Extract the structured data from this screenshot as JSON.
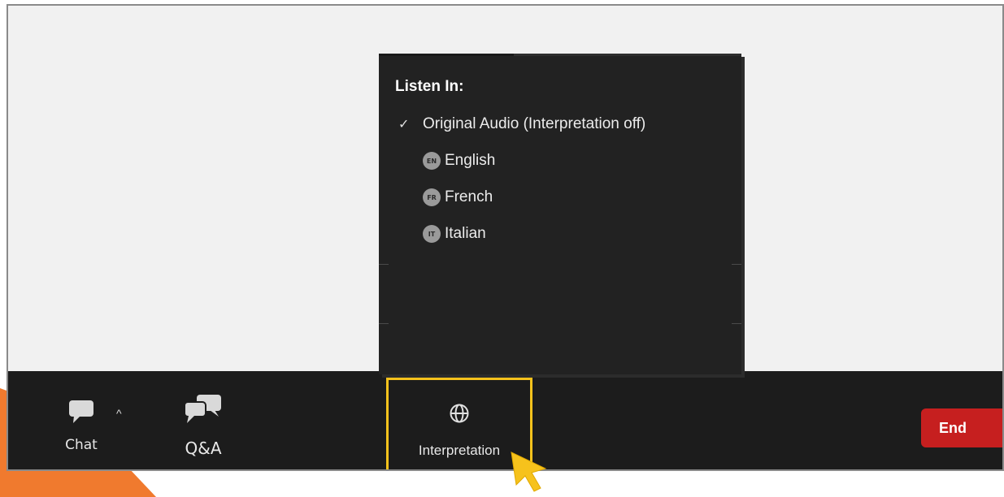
{
  "popup": {
    "header": "Listen In:",
    "original_option": {
      "label": "Original Audio (Interpretation off)",
      "checked": true
    },
    "languages": [
      {
        "code": "EN",
        "label": "English"
      },
      {
        "code": "FR",
        "label": "French"
      },
      {
        "code": "IT",
        "label": "Italian"
      }
    ]
  },
  "toolbar": {
    "chat_label": "Chat",
    "qa_label": "Q&A",
    "interpretation_label": "Interpretation",
    "end_label": "End"
  },
  "colors": {
    "toolbar_bg": "#1c1c1c",
    "popup_bg": "#222222",
    "highlight": "#f6c21c",
    "end_button": "#c61f1f",
    "accent_orange": "#f07a2e"
  },
  "icons": {
    "chat": "chat-bubble-icon",
    "qa": "qa-bubbles-icon",
    "interpretation": "globe-icon",
    "cursor": "pointer-arrow-icon"
  }
}
